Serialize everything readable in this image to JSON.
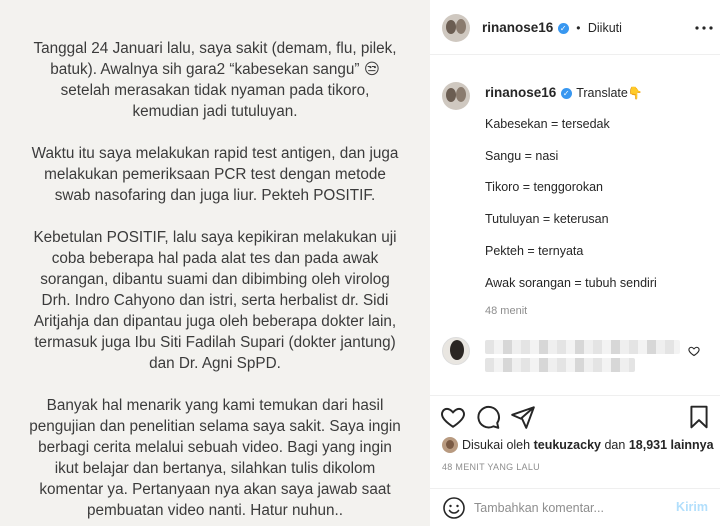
{
  "post": {
    "paragraphs": [
      "Tanggal 24 Januari lalu, saya sakit (demam, flu, pilek,\nbatuk). Awalnya sih gara2 “kabesekan sangu” 😒\nsetelah merasakan tidak nyaman pada tikoro,\nkemudian jadi tutuluyan.",
      "Waktu itu saya melakukan rapid test antigen, dan juga\nmelakukan pemeriksaan PCR test dengan metode\nswab nasofaring dan juga liur. Pekteh POSITIF.",
      "Kebetulan POSITIF, lalu saya kepikiran melakukan uji\ncoba beberapa hal pada alat tes dan pada awak\nsorangan, dibantu suami dan dibimbing oleh virolog\nDrh. Indro Cahyono dan istri, serta herbalist dr. Sidi\nAritjahja dan dipantau juga oleh beberapa dokter lain,\ntermasuk juga Ibu Siti Fadilah Supari (dokter jantung)\ndan Dr. Agni SpPD.",
      "Banyak hal menarik yang kami temukan dari hasil\npengujian dan penelitian selama saya sakit. Saya ingin\nberbagi cerita melalui sebuah video. Bagi yang ingin\nikut belajar dan bertanya, silahkan tulis dikolom\nkomentar ya. Pertanyaan nya akan saya jawab saat\npembuatan video nanti. Hatur nuhun.."
    ]
  },
  "header": {
    "username": "rinanose16",
    "verified_mark": "✓",
    "separator": "•",
    "follow_status": "Diikuti",
    "more_icon": "more-horizontal-icon"
  },
  "caption": {
    "username": "rinanose16",
    "verified_mark": "✓",
    "translate": "Translate",
    "translate_emoji": "👇",
    "lines": [
      "Kabesekan = tersedak",
      "Sangu = nasi",
      "Tikoro = tenggorokan",
      "Tutuluyan = keterusan",
      "Pekteh = ternyata",
      "Awak sorangan = tubuh sendiri"
    ],
    "time": "48 menit"
  },
  "comment": {
    "like_icon": "heart-icon"
  },
  "actions": {
    "icons": [
      "heart-icon",
      "comment-icon",
      "share-icon",
      "bookmark-icon"
    ]
  },
  "likes": {
    "prefix": "Disukai oleh",
    "user": "teukuzacky",
    "connector": "dan",
    "count": "18,931 lainnya"
  },
  "timestamp": "48 MENIT YANG LALU",
  "comment_box": {
    "placeholder": "Tambahkan komentar...",
    "post_label": "Kirim",
    "emoji_icon": "smiley-icon"
  },
  "colors": {
    "accent": "#3897f0",
    "post_disabled": "#b2dffc",
    "image_bg": "#f3f2ef"
  }
}
